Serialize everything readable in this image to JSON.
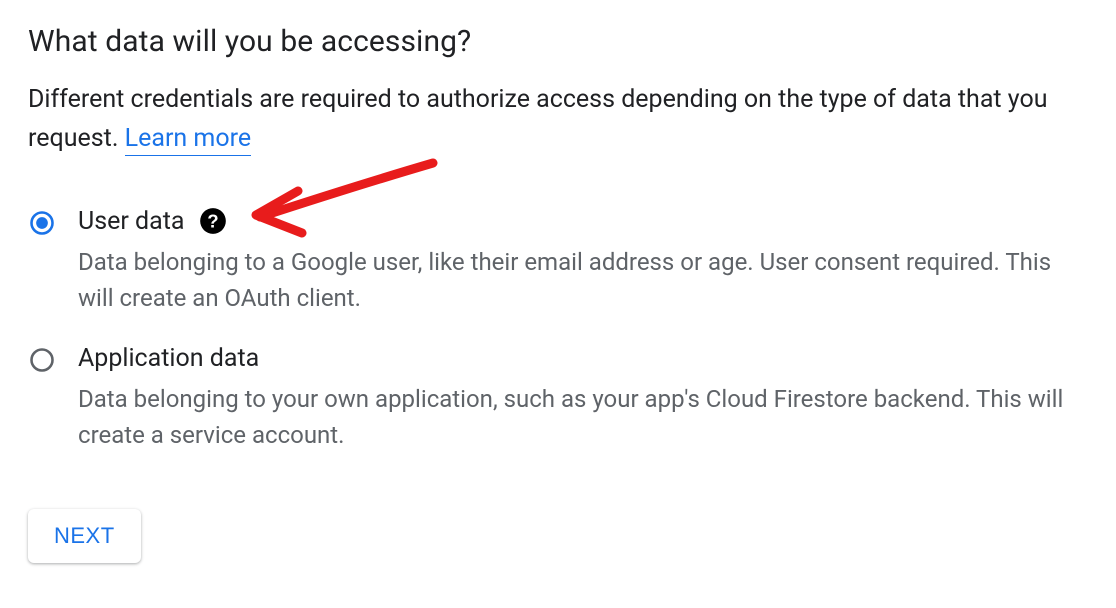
{
  "heading": "What data will you be accessing?",
  "description_prefix": "Different credentials are required to authorize access depending on the type of data that you request. ",
  "learn_more_label": "Learn more",
  "options": [
    {
      "value": "user-data",
      "title": "User data",
      "description": "Data belonging to a Google user, like their email address or age. User consent required. This will create an OAuth client.",
      "selected": true,
      "show_help": true
    },
    {
      "value": "application-data",
      "title": "Application data",
      "description": "Data belonging to your own application, such as your app's Cloud Firestore backend. This will create a service account.",
      "selected": false,
      "show_help": false
    }
  ],
  "next_button_label": "NEXT",
  "colors": {
    "accent": "#1a73e8",
    "text_secondary": "#5f6368",
    "annotation": "#e81c1c"
  }
}
